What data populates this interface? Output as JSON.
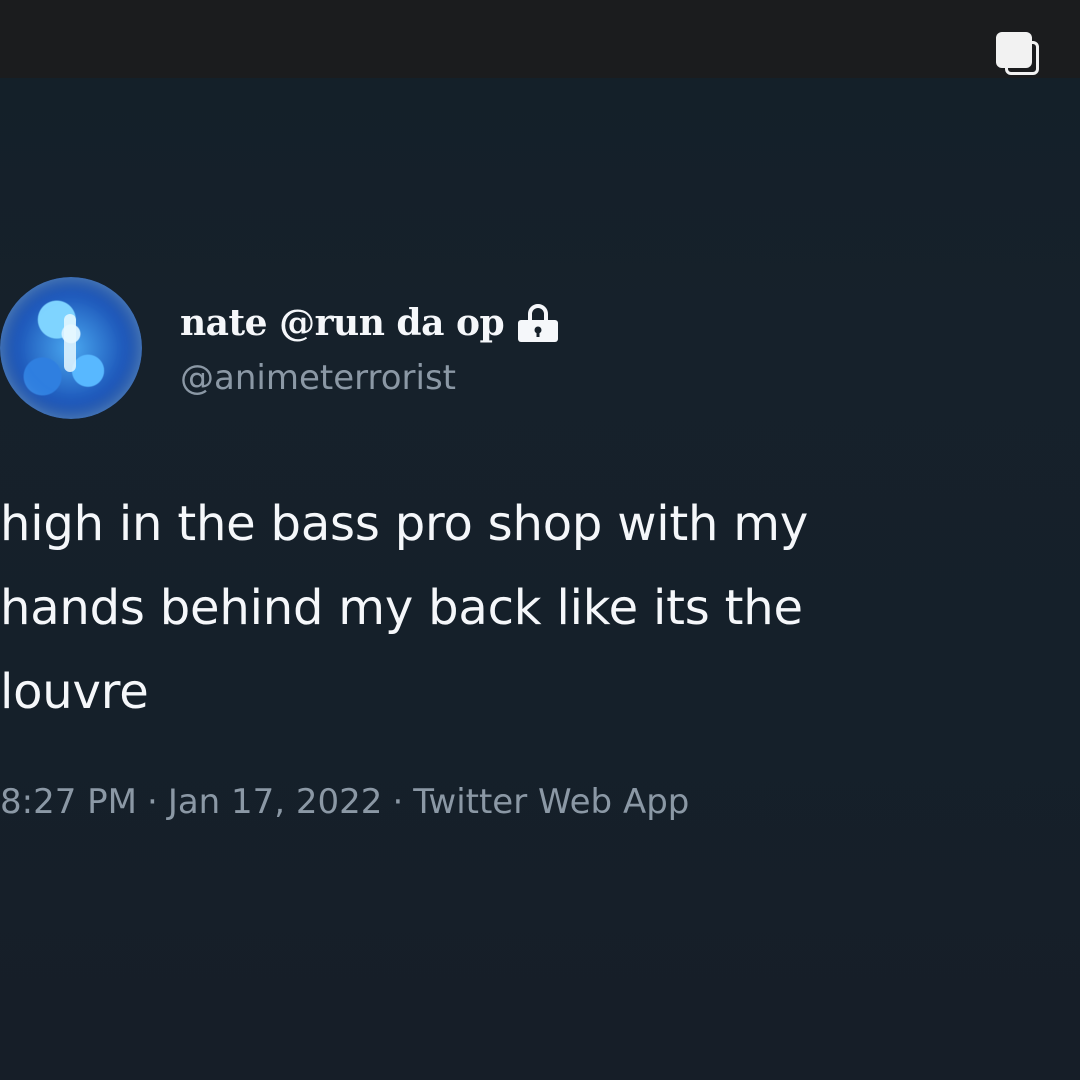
{
  "tweet": {
    "display_name": "nate @run da op",
    "handle": "@animeterrorist",
    "text": "high in the bass pro shop with my\nhands behind my back like its the\nlouvre",
    "time": "8:27 PM",
    "separator": "·",
    "date": "Jan 17, 2022",
    "source": "Twitter Web App"
  },
  "icons": {
    "multi_post": "multiple-posts-icon",
    "lock": "lock-icon"
  },
  "colors": {
    "background": "#16202a",
    "text_primary": "#f5f7fa",
    "text_secondary": "#8b98a5"
  }
}
